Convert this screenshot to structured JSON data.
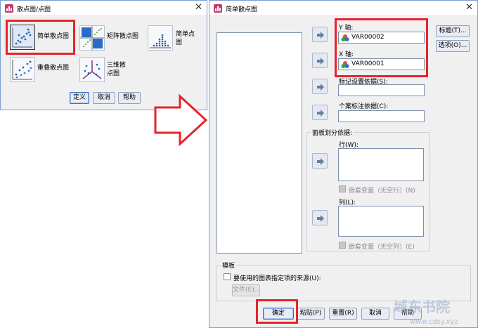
{
  "dialog1": {
    "title": "散点图/点图",
    "close_glyph": "✕",
    "chart_types": [
      {
        "label": "简单散点图",
        "icon": "simple-scatter-icon",
        "selected": true
      },
      {
        "label": "矩阵散点图",
        "icon": "matrix-scatter-icon",
        "selected": false
      },
      {
        "label": "简单点\n图",
        "icon": "simple-dot-icon",
        "selected": false
      },
      {
        "label": "重叠散点图",
        "icon": "overlay-scatter-icon",
        "selected": false
      },
      {
        "label": "三维散\n点图",
        "icon": "3d-scatter-icon",
        "selected": false
      }
    ],
    "buttons": {
      "define": "定义",
      "cancel": "取消",
      "help": "帮助"
    }
  },
  "dialog2": {
    "title": "简单散点图",
    "close_glyph": "✕",
    "y_axis": {
      "label": "Y 轴:",
      "value": "VAR00002"
    },
    "x_axis": {
      "label": "X 轴:",
      "value": "VAR00001"
    },
    "marker_label": "标记设置依据(S):",
    "case_label": "个案标注依据(C):",
    "panel": {
      "title": "面板划分依据:",
      "rows_label": "行(W):",
      "rows_nest": "嵌套变量（无空行）(N)",
      "cols_label": "列(L):",
      "cols_nest": "嵌套变量（无空列）(E)"
    },
    "template": {
      "title": "模板",
      "use_chart_spec": "要使用的图表指定项的来源(U):",
      "file_button": "文件(E)..."
    },
    "side_buttons": {
      "titles": "标题(T)...",
      "options": "选项(O)..."
    },
    "bottom_buttons": {
      "ok": "确定",
      "paste": "粘贴(P)",
      "reset": "重置(R)",
      "cancel": "取消",
      "help": "帮助"
    }
  },
  "watermark": {
    "line1": "域东书院",
    "line2": "www.cdsy.xyz"
  },
  "colors": {
    "highlight_red": "#e8232a",
    "dialog_bg": "#f0f0f0",
    "border_blue": "#7a9ed0"
  }
}
